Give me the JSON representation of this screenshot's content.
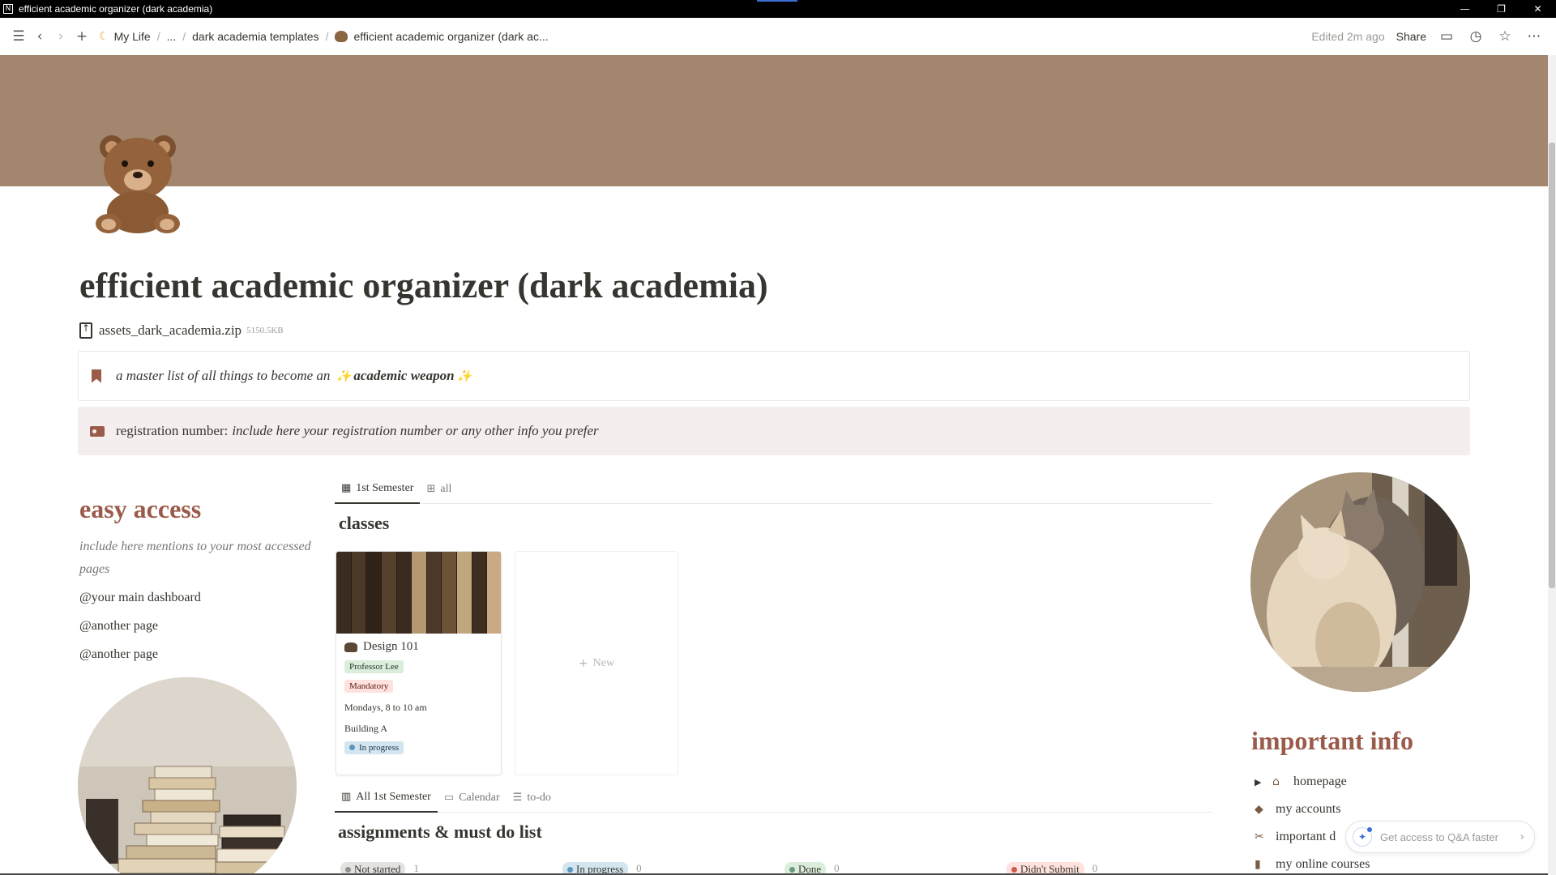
{
  "window": {
    "title": "efficient academic organizer (dark academia)"
  },
  "topbar": {
    "breadcrumbs": [
      "My Life",
      "...",
      "dark academia templates",
      "efficient academic organizer (dark ac..."
    ],
    "edited": "Edited 2m ago",
    "share": "Share"
  },
  "page": {
    "title": "efficient academic organizer (dark academia)",
    "file": {
      "name": "assets_dark_academia.zip",
      "size": "5150.5KB"
    },
    "callout1": {
      "prefix": "a master list of all things to become an",
      "highlight": "academic weapon"
    },
    "callout2": {
      "label": "registration number:",
      "value": "include here your registration number or any other info you prefer"
    }
  },
  "easy_access": {
    "heading": "easy access",
    "description": "include here mentions to your most accessed pages",
    "mentions": [
      "@your main dashboard",
      "@another page",
      "@another page"
    ]
  },
  "classes": {
    "tabs": [
      "1st Semester",
      "all"
    ],
    "heading": "classes",
    "card": {
      "title": "Design 101",
      "professor": "Professor Lee",
      "type": "Mandatory",
      "schedule": "Mondays, 8 to 10 am",
      "location": "Building A",
      "status": "In progress"
    },
    "new_label": "New"
  },
  "assignments": {
    "tabs": [
      "All 1st Semester",
      "Calendar",
      "to-do"
    ],
    "heading": "assignments & must do list",
    "columns": [
      {
        "name": "Not started",
        "count": "1",
        "color": "#91918e",
        "bg": "#e3e2e0"
      },
      {
        "name": "In progress",
        "count": "0",
        "color": "#5b97bd",
        "bg": "#d3e5ef"
      },
      {
        "name": "Done",
        "count": "0",
        "color": "#6c9b7d",
        "bg": "#dbeddb"
      },
      {
        "name": "Didn't Submit",
        "count": "0",
        "color": "#cd5b4f",
        "bg": "#ffe2dd"
      }
    ]
  },
  "important_info": {
    "heading": "important info",
    "items": [
      "homepage",
      "my accounts",
      "important d",
      "my online courses"
    ]
  },
  "qa": {
    "label": "Get access to Q&A faster"
  }
}
